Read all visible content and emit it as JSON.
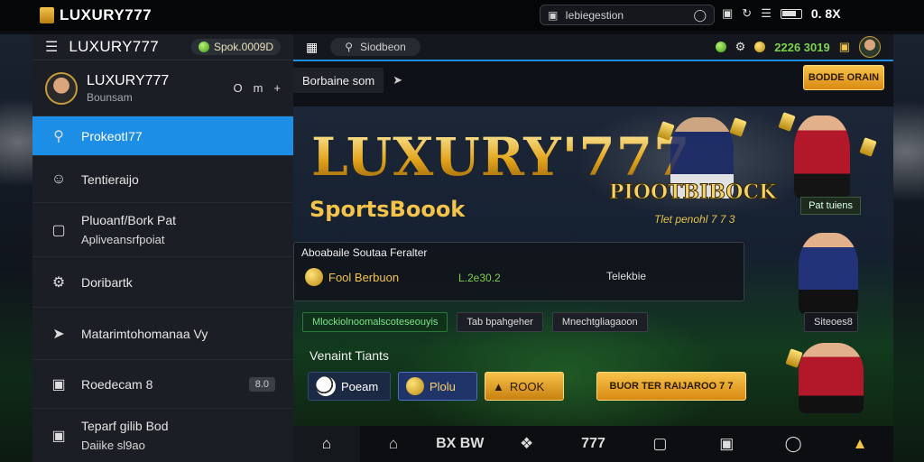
{
  "statusbar": {
    "app_title": "LUXURY777",
    "url": "Iebiegestion",
    "time": "0. 8X",
    "icons": [
      "lock-icon",
      "reload-icon",
      "screenshot-icon",
      "signal-icon",
      "battery-icon"
    ]
  },
  "sidebar": {
    "brand": "LUXURY777",
    "balance": "Spok.0009D",
    "profile": {
      "name": "LUXURY777",
      "subtitle": "Bounsam",
      "controls": [
        "O",
        "m",
        "+"
      ]
    },
    "items": [
      {
        "label": "ProkeotI77",
        "icon": "search-icon",
        "active": true
      },
      {
        "label": "Tentieraijo",
        "icon": "user-icon"
      },
      {
        "label": "Pluoanf/Bork Pat",
        "sub": "Apliveansrfpoiat",
        "icon": "square-icon"
      },
      {
        "label": "Doribartk",
        "icon": "gear-icon"
      },
      {
        "label": "Matarimtohomanaa Vy",
        "icon": "send-icon"
      },
      {
        "label": "Roedecam 8",
        "icon": "download-icon",
        "count": "8.0"
      },
      {
        "label": "Teparf gilib Bod",
        "sub": "Daiike sl9ao",
        "icon": "chat-icon"
      }
    ]
  },
  "topbar": {
    "search_label": "Siodbeon",
    "credits": "2226 3019",
    "icons": [
      "grid-icon",
      "search-icon",
      "gem-icon",
      "gear-icon",
      "coin-icon",
      "wallet-icon"
    ]
  },
  "subheader": {
    "crumb": "Borbaine som",
    "cta": "BODDE ORAIN"
  },
  "hero": {
    "title": "LUXURY'777",
    "sportsbook": "SportsBoook",
    "badge": "PIOOTBIBOCK",
    "badge_sub": "Tlet penohl 7 7 3",
    "tag": "Pat tuiens"
  },
  "panel": {
    "title": "Aboabaile Soutaa Feralter",
    "item_label": "Fool Berbuon",
    "item_value": "L.2e30.2",
    "right_label": "Telekbie"
  },
  "chips": [
    "Mlockiolnoomalscoteseouyis",
    "Tab bpahgeher",
    "Mnechtgliagaoon",
    "Siteoes8"
  ],
  "section": {
    "title": "Venaint Tiants",
    "buttons": [
      "Poeam",
      "Plolu",
      "ROOK"
    ],
    "big_cta": "BUOR TER RAIJAROO 7 7"
  },
  "bottom_nav": [
    "home-icon",
    "home-outline-icon",
    "BX BW",
    "puzzle-icon",
    "777",
    "square-icon",
    "bookmark-icon",
    "shield-icon",
    "bell-icon"
  ]
}
